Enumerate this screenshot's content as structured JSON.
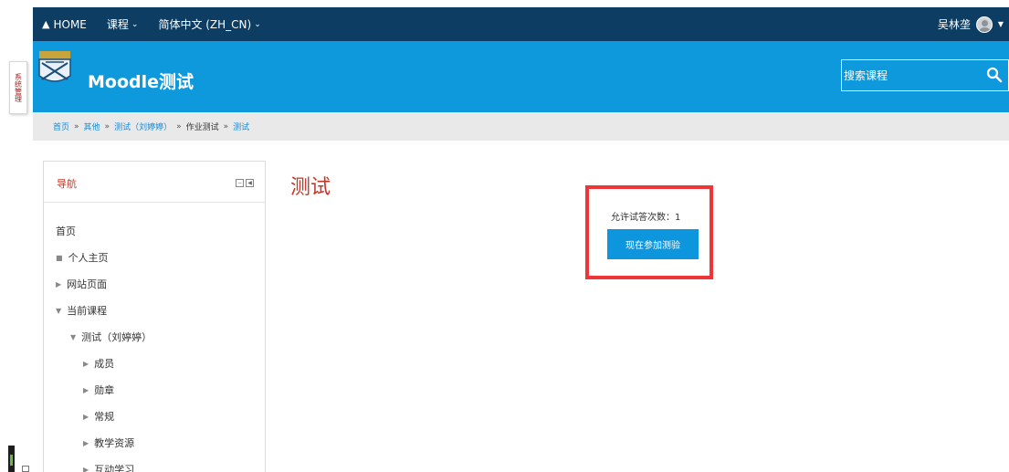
{
  "topbar": {
    "home_label": "HOME",
    "course_menu": "课程",
    "language_menu": "简体中文 (ZH_CN)",
    "user_name": "吴林垄"
  },
  "header": {
    "site_title": "Moodle测试",
    "search_placeholder": "搜索课程"
  },
  "admin_tab": {
    "label": "系统管理"
  },
  "breadcrumb": [
    {
      "label": "首页",
      "link": true
    },
    {
      "label": "其他",
      "link": true
    },
    {
      "label": "测试（刘婷婷）",
      "link": true
    },
    {
      "label": "作业测试",
      "link": false
    },
    {
      "label": "测试",
      "link": true
    }
  ],
  "navigation": {
    "title": "导航",
    "items": [
      {
        "label": "首页",
        "marker": ""
      },
      {
        "label": "个人主页",
        "marker": "■"
      },
      {
        "label": "网站页面",
        "marker": "▶"
      },
      {
        "label": "当前课程",
        "marker": "▼"
      },
      {
        "label": "测试（刘婷婷）",
        "marker": "▼"
      },
      {
        "label": "成员",
        "marker": "▶"
      },
      {
        "label": "勋章",
        "marker": "▶"
      },
      {
        "label": "常规",
        "marker": "▶"
      },
      {
        "label": "教学资源",
        "marker": "▶"
      },
      {
        "label": "互动学习",
        "marker": "▶"
      }
    ]
  },
  "main": {
    "page_title": "测试",
    "attempts_allowed": "允许试答次数：1",
    "attempt_button": "现在参加测验"
  },
  "colors": {
    "topbar": "#0d3d62",
    "header": "#0f99dd",
    "accent_red": "#c0392b",
    "highlight_border": "#ef3537",
    "button": "#0d96de"
  }
}
